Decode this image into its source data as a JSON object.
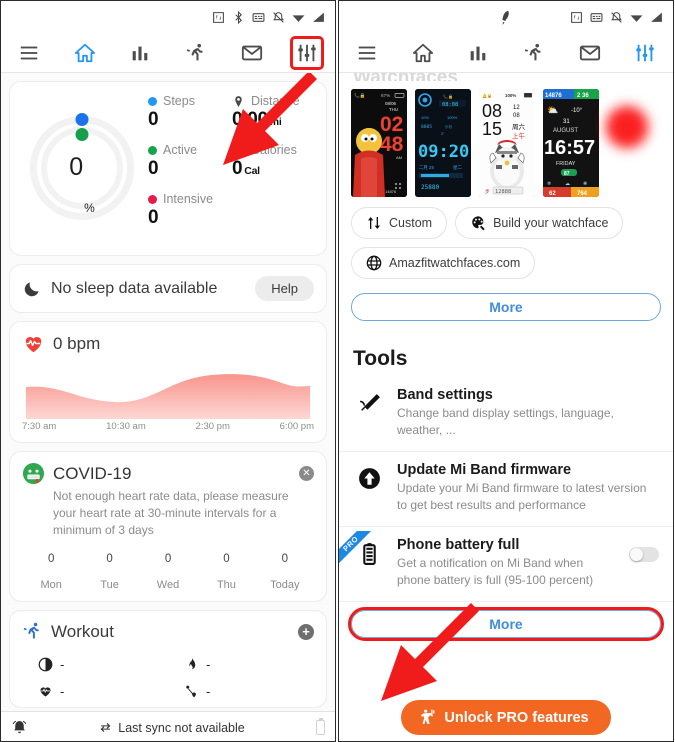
{
  "left": {
    "statusbar": {
      "icons": [
        "nfc-icon",
        "bluetooth-icon",
        "vpn-icon",
        "mute-icon",
        "wifi-icon",
        "signal-icon"
      ]
    },
    "nav": [
      {
        "name": "menu-icon",
        "label": "Menu",
        "active": false
      },
      {
        "name": "home-icon",
        "label": "Home",
        "active": true
      },
      {
        "name": "stats-icon",
        "label": "Statistics",
        "active": false
      },
      {
        "name": "workout-icon",
        "label": "Workout",
        "active": false
      },
      {
        "name": "mail-icon",
        "label": "Notifications",
        "active": false
      },
      {
        "name": "sliders-icon",
        "label": "Settings",
        "active": false
      }
    ],
    "dashboard": {
      "ring_value": "0",
      "ring_unit": "%",
      "stats": [
        {
          "label": "Steps",
          "value": "0",
          "unit": "",
          "marker": "dot-blue"
        },
        {
          "label": "Active",
          "value": "0",
          "unit": "",
          "marker": "dot-green"
        },
        {
          "label": "Intensive",
          "value": "0",
          "unit": "",
          "marker": "dot-pink"
        },
        {
          "label": "Distance",
          "value": "0.00",
          "unit": "mi",
          "marker": "distance-icon"
        },
        {
          "label": "Calories",
          "value": "0",
          "unit": "Cal",
          "marker": "flame-icon"
        }
      ]
    },
    "sleep": {
      "title": "No sleep data available",
      "button": "Help"
    },
    "heart": {
      "value": "0 bpm",
      "axis": [
        "7:30 am",
        "10:30 am",
        "2:30 pm",
        "6:00 pm"
      ]
    },
    "covid": {
      "title": "COVID-19",
      "description": "Not enough heart rate data, please measure your heart rate at 30-minute intervals for a minimum of 3 days",
      "values": [
        "0",
        "0",
        "0",
        "0",
        "0"
      ],
      "days": [
        "Mon",
        "Tue",
        "Wed",
        "Thu",
        "Today"
      ]
    },
    "workout": {
      "title": "Workout",
      "metrics": [
        {
          "icon": "duration-icon",
          "value": "-"
        },
        {
          "icon": "flame-icon",
          "value": "-"
        },
        {
          "icon": "heart-icon",
          "value": "-"
        },
        {
          "icon": "pace-icon",
          "value": "-"
        }
      ]
    },
    "bottom": {
      "sync_text": "Last sync not available"
    }
  },
  "right": {
    "statusbar": {
      "icons": [
        "nfc-icon",
        "vpn-icon",
        "mute-icon",
        "wifi-icon",
        "signal-icon"
      ]
    },
    "nav": [
      {
        "name": "menu-icon",
        "label": "Menu",
        "active": false
      },
      {
        "name": "home-icon",
        "label": "Home",
        "active": false
      },
      {
        "name": "stats-icon",
        "label": "Statistics",
        "active": false
      },
      {
        "name": "workout-icon",
        "label": "Workout",
        "active": false
      },
      {
        "name": "mail-icon",
        "label": "Notifications",
        "active": false
      },
      {
        "name": "sliders-icon",
        "label": "Settings",
        "active": true
      }
    ],
    "watchfaces_heading": "Watchfaces",
    "watchfaces": [
      {
        "name": "watchface-bart",
        "time": "02 48",
        "date": "08/06 THU",
        "steps": "14876",
        "battery": "67%"
      },
      {
        "name": "watchface-blue",
        "time": "09:20",
        "clock": "08:08",
        "steps": "25880",
        "battery": "100%"
      },
      {
        "name": "watchface-cat",
        "time": "08 15",
        "date": "12 08 周六 上午",
        "battery": "100%"
      },
      {
        "name": "watchface-colored",
        "time": "16:57",
        "date": "31 AUGUST FRIDAY",
        "temp": "-10°",
        "steps": "14876",
        "extra": "2 36"
      }
    ],
    "chips": [
      {
        "name": "custom-chip",
        "label": "Custom",
        "icon": "transfer-icon"
      },
      {
        "name": "build-chip",
        "label": "Build your watchface",
        "icon": "palette-icon"
      },
      {
        "name": "website-chip",
        "label": "Amazfitwatchfaces.com",
        "icon": "globe-icon"
      }
    ],
    "more_watchfaces": "More",
    "tools_heading": "Tools",
    "tools": [
      {
        "name": "band-settings",
        "title": "Band settings",
        "desc": "Change band display settings, language, weather, ...",
        "icon": "band-icon",
        "pro": false,
        "toggle": null
      },
      {
        "name": "update-firmware",
        "title": "Update Mi Band firmware",
        "desc": "Update your Mi Band firmware to latest version to get best results and performance",
        "icon": "upload-icon",
        "pro": false,
        "toggle": null
      },
      {
        "name": "phone-battery-full",
        "title": "Phone battery full",
        "desc": "Get a notification on Mi Band when phone battery is full (95-100 percent)",
        "icon": "battery-icon",
        "pro": true,
        "pro_label": "PRO",
        "toggle": "off"
      }
    ],
    "more_tools": "More",
    "unlock": {
      "label": "Unlock PRO features",
      "icon": "weightlifter-icon"
    }
  },
  "colors": {
    "accent_blue": "#2196f3",
    "link_blue": "#3f8ede",
    "annotation_red": "#f01b1b",
    "orange": "#f26722",
    "steps_blue": "#2196f3",
    "active_green": "#16a34a",
    "intensive_pink": "#e81a4c",
    "heart_red": "#ef4136"
  }
}
